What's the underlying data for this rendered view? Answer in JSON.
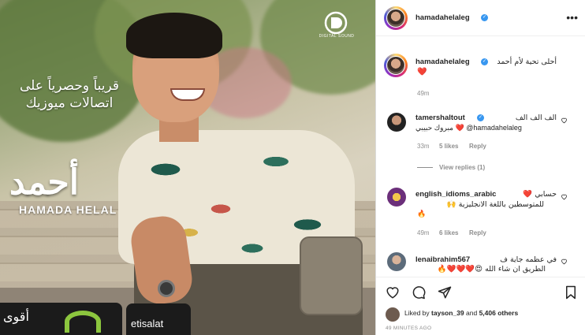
{
  "media": {
    "promo_line1": "قريباً وحصرياً على",
    "promo_line2": "اتصالات ميوزيك",
    "album_title": "أحمد",
    "artist_name": "HAMADA HELAL",
    "logo_label": "DIGITAL SOUND",
    "sponsor_tagline": "أقوى",
    "sponsor_name": "etisalat"
  },
  "post": {
    "author": "hamadahelaleg",
    "caption_username": "hamadahelaleg",
    "caption_text": "أحلى تحية لأم أحمد",
    "caption_emoji": "❤️",
    "caption_time": "49m"
  },
  "comments": [
    {
      "username": "tamershaltout",
      "line1": "الف الف الف",
      "line2": "مبروك حبيبي ❤️ @hamadahelaleg",
      "time": "33m",
      "likes": "5 likes",
      "reply": "Reply",
      "view_replies": "View replies (1)"
    },
    {
      "username": "english_idioms_arabic",
      "line1": "حسابي ❤️",
      "line2": "للمتوسطين باللغة الانجليزية 🙌",
      "line3": "🔥",
      "time": "49m",
      "likes": "6 likes",
      "reply": "Reply"
    },
    {
      "username": "lenaibrahim567",
      "line1": "في عظمه جاية ف",
      "line2": "الطريق ان شاء الله 😍❤️❤️❤️🔥"
    }
  ],
  "footer": {
    "liked_prefix": "Liked by",
    "liked_user": "tayson_39",
    "liked_and": "and",
    "liked_others": "5,406 others",
    "time_ago": "49 MINUTES AGO"
  }
}
